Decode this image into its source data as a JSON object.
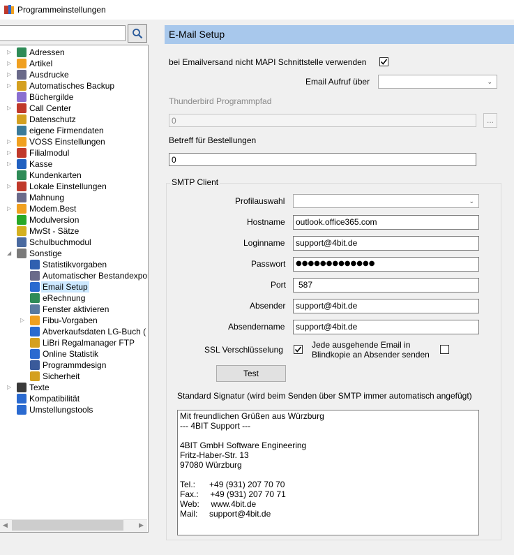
{
  "window": {
    "title": "Programmeinstellungen"
  },
  "search": {
    "value": ""
  },
  "tree": {
    "items": [
      {
        "label": "Adressen",
        "depth": 0,
        "expander": true,
        "icon": "person-icon",
        "color": "#2e8b57"
      },
      {
        "label": "Artikel",
        "depth": 0,
        "expander": true,
        "icon": "star-icon",
        "color": "#f0a020"
      },
      {
        "label": "Ausdrucke",
        "depth": 0,
        "expander": true,
        "icon": "printer-icon",
        "color": "#6a6a8a"
      },
      {
        "label": "Automatisches Backup",
        "depth": 0,
        "expander": true,
        "icon": "backup-icon",
        "color": "#d4a020"
      },
      {
        "label": "Büchergilde",
        "depth": 0,
        "expander": false,
        "icon": "diamond-icon",
        "color": "#8a6fd0"
      },
      {
        "label": "Call Center",
        "depth": 0,
        "expander": true,
        "icon": "phone-icon",
        "color": "#c0392b"
      },
      {
        "label": "Datenschutz",
        "depth": 0,
        "expander": false,
        "icon": "lock-icon",
        "color": "#d4a020"
      },
      {
        "label": "eigene Firmendaten",
        "depth": 0,
        "expander": false,
        "icon": "building-icon",
        "color": "#3a7a9a"
      },
      {
        "label": "VOSS Einstellungen",
        "depth": 0,
        "expander": true,
        "icon": "star-icon",
        "color": "#f0a020"
      },
      {
        "label": "Filialmodul",
        "depth": 0,
        "expander": true,
        "icon": "shop-icon",
        "color": "#c0392b"
      },
      {
        "label": "Kasse",
        "depth": 0,
        "expander": true,
        "icon": "register-icon",
        "color": "#2060c0"
      },
      {
        "label": "Kundenkarten",
        "depth": 0,
        "expander": false,
        "icon": "person-icon",
        "color": "#2e8b57"
      },
      {
        "label": "Lokale Einstellungen",
        "depth": 0,
        "expander": true,
        "icon": "wrench-icon",
        "color": "#c0392b"
      },
      {
        "label": "Mahnung",
        "depth": 0,
        "expander": false,
        "icon": "printer-icon",
        "color": "#6a6a8a"
      },
      {
        "label": "Modem.Best",
        "depth": 0,
        "expander": true,
        "icon": "star-icon",
        "color": "#f0a020"
      },
      {
        "label": "Modulversion",
        "depth": 0,
        "expander": false,
        "icon": "green-circle-icon",
        "color": "#28a828"
      },
      {
        "label": "MwSt - Sätze",
        "depth": 0,
        "expander": false,
        "icon": "coins-icon",
        "color": "#d4b020"
      },
      {
        "label": "Schulbuchmodul",
        "depth": 0,
        "expander": false,
        "icon": "keyboard-icon",
        "color": "#4a6aa0"
      },
      {
        "label": "Sonstige",
        "depth": 0,
        "expander": "open",
        "icon": "wrench-icon",
        "color": "#7a7a7a"
      },
      {
        "label": "Statistikvorgaben",
        "depth": 1,
        "expander": false,
        "icon": "chart-icon",
        "color": "#3060b0"
      },
      {
        "label": "Automatischer Bestandexport",
        "depth": 1,
        "expander": false,
        "icon": "print-icon",
        "color": "#6a6a8a"
      },
      {
        "label": "Email Setup",
        "depth": 1,
        "expander": false,
        "icon": "email-icon",
        "color": "#2a6ad0",
        "selected": true
      },
      {
        "label": "eRechnung",
        "depth": 1,
        "expander": false,
        "icon": "invoice-icon",
        "color": "#2e8b57"
      },
      {
        "label": "Fenster aktivieren",
        "depth": 1,
        "expander": false,
        "icon": "window-icon",
        "color": "#5a7aa0"
      },
      {
        "label": "Fibu-Vorgaben",
        "depth": 1,
        "expander": true,
        "icon": "star-icon",
        "color": "#f0a020"
      },
      {
        "label": "Abverkaufsdaten LG-Buch (",
        "depth": 1,
        "expander": false,
        "icon": "export-icon",
        "color": "#2a6ad0"
      },
      {
        "label": "LiBri Regalmanager FTP",
        "depth": 1,
        "expander": false,
        "icon": "lock-icon",
        "color": "#d4a020"
      },
      {
        "label": "Online Statistik",
        "depth": 1,
        "expander": false,
        "icon": "globe-icon",
        "color": "#2a6ad0"
      },
      {
        "label": "Programmdesign",
        "depth": 1,
        "expander": false,
        "icon": "grid-icon",
        "color": "#3a5a9a"
      },
      {
        "label": "Sicherheit",
        "depth": 1,
        "expander": false,
        "icon": "lock-icon",
        "color": "#d4a020"
      },
      {
        "label": "Texte",
        "depth": 0,
        "expander": true,
        "icon": "text-icon",
        "color": "#3a3a3a"
      },
      {
        "label": "Kompatibilität",
        "depth": 0,
        "expander": false,
        "icon": "puzzle-icon",
        "color": "#2a6ad0"
      },
      {
        "label": "Umstellungstools",
        "depth": 0,
        "expander": false,
        "icon": "tools-icon",
        "color": "#2a6ad0"
      }
    ]
  },
  "panel": {
    "title": "E-Mail Setup",
    "mapi_label": "bei Emailversand nicht MAPI Schnittstelle verwenden",
    "mapi_checked": true,
    "email_aufruf_label": "Email Aufruf über",
    "email_aufruf_value": "",
    "thunderbird_label": "Thunderbird Programmpfad",
    "thunderbird_value": "0",
    "browse_label": "...",
    "betreff_label": "Betreff für Bestellungen",
    "betreff_value": "0"
  },
  "smtp": {
    "group_title": "SMTP Client",
    "profil_label": "Profilauswahl",
    "profil_value": "",
    "hostname_label": "Hostname",
    "hostname_value": "outlook.office365.com",
    "login_label": "Loginname",
    "login_value": "support@4bit.de",
    "passwort_label": "Passwort",
    "passwort_value": "●●●●●●●●●●●●●",
    "port_label": "Port",
    "port_value": "587",
    "absender_label": "Absender",
    "absender_value": "support@4bit.de",
    "absendername_label": "Absendername",
    "absendername_value": "support@4bit.de",
    "ssl_label": "SSL Verschlüsselung",
    "ssl_checked": true,
    "bcc_label_1": "Jede ausgehende Email in",
    "bcc_label_2": "Blindkopie an Absender senden",
    "bcc_checked": false,
    "test_label": "Test",
    "signature_label": "Standard Signatur (wird beim Senden über SMTP immer automatisch angefügt)",
    "signature_lines": [
      "Mit freundlichen Grüßen aus Würzburg",
      "--- 4BIT Support ---",
      "",
      "4BIT GmbH Software Engineering",
      "Fritz-Haber-Str. 13",
      "97080 Würzburg",
      "",
      "Tel.:      +49 (931) 207 70 70",
      "Fax.:     +49 (931) 207 70 71",
      "Web:     www.4bit.de",
      "Mail:     support@4bit.de"
    ]
  }
}
